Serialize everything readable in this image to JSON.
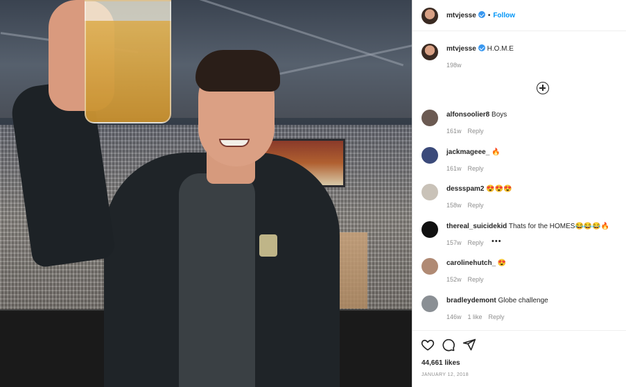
{
  "post": {
    "photo_alt": "Man raising a cup of beer in an arena box",
    "author": {
      "username": "mtvjesse",
      "verified": true
    },
    "follow_label": "Follow",
    "dot": "•",
    "caption": {
      "username": "mtvjesse",
      "text": "H.O.M.E",
      "time": "198w"
    },
    "comments": [
      {
        "username": "alfonsoolier8",
        "text": "Boys",
        "time": "161w",
        "likes": "",
        "reply": "Reply",
        "avatar_color": "#6b5a52"
      },
      {
        "username": "jackmageee_",
        "text": "🔥",
        "time": "161w",
        "likes": "",
        "reply": "Reply",
        "avatar_color": "#3b4a7a"
      },
      {
        "username": "dessspam2",
        "text": "😍😍😍",
        "time": "158w",
        "likes": "",
        "reply": "Reply",
        "avatar_color": "#c9c2b8"
      },
      {
        "username": "thereal_suicidekid",
        "text": "Thats for the HOMES😂😂😂🔥",
        "time": "157w",
        "likes": "",
        "reply": "Reply",
        "avatar_color": "#111111"
      },
      {
        "username": "carolinehutch_",
        "text": "😍",
        "time": "152w",
        "likes": "",
        "reply": "Reply",
        "avatar_color": "#b08a74"
      },
      {
        "username": "bradleydemont",
        "text": "Globe challenge",
        "time": "146w",
        "likes": "1 like",
        "reply": "Reply",
        "avatar_color": "#8a8f94"
      }
    ],
    "more_label": "•••",
    "likes_count": "44,661 likes",
    "date": "JANUARY 12, 2018"
  },
  "icons": {
    "like": "heart-icon",
    "comment": "comment-icon",
    "share": "paper-plane-icon",
    "add_comments": "plus-circle-icon",
    "verified": "verified-badge-icon"
  },
  "colors": {
    "accent": "#0095f6",
    "text": "#262626",
    "muted": "#8e8e8e",
    "verified": "#3897f0"
  }
}
